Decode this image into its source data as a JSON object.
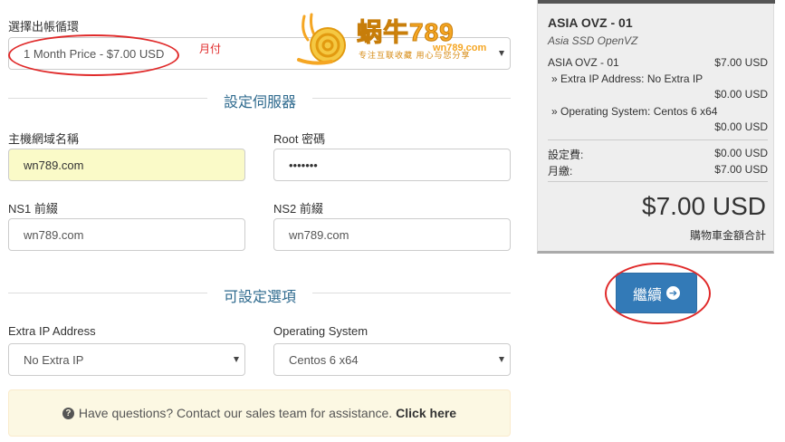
{
  "billing": {
    "label": "選擇出帳循環",
    "selected": "1 Month Price - $7.00 USD",
    "annotation": "月付"
  },
  "logo": {
    "cn_text": "蜗牛789",
    "url_text": "wn789.com",
    "tagline": "专注互联收藏   用心与您分享"
  },
  "server_section": {
    "title": "設定伺服器",
    "hostname_label": "主機網域名稱",
    "hostname_value": "wn789.com",
    "root_label": "Root 密碼",
    "root_value": "•••••••",
    "ns1_label": "NS1 前綴",
    "ns1_value": "wn789.com",
    "ns2_label": "NS2 前綴",
    "ns2_value": "wn789.com"
  },
  "options_section": {
    "title": "可設定選項",
    "extra_ip_label": "Extra IP Address",
    "extra_ip_selected": "No Extra IP",
    "os_label": "Operating System",
    "os_selected": "Centos 6 x64"
  },
  "help": {
    "text": "Have questions? Contact our sales team for assistance.",
    "link": "Click here"
  },
  "summary": {
    "product_name": "ASIA OVZ - 01",
    "product_group": "Asia SSD OpenVZ",
    "lines": [
      {
        "label": "ASIA OVZ - 01",
        "value": "$7.00 USD"
      },
      {
        "label": "» Extra IP Address: No Extra IP",
        "value": ""
      },
      {
        "label": "",
        "value": "$0.00 USD"
      },
      {
        "label": "» Operating System: Centos 6 x64",
        "value": ""
      },
      {
        "label": "",
        "value": "$0.00 USD"
      }
    ],
    "setup_label": "設定費:",
    "setup_value": "$0.00 USD",
    "monthly_label": "月繳:",
    "monthly_value": "$7.00 USD",
    "total": "$7.00 USD",
    "total_label": "購物車金額合計"
  },
  "continue_button": "繼續",
  "colors": {
    "primary": "#337ab7",
    "section_title": "#2e6a8e",
    "annotation": "#e02a2a",
    "highlight_input": "#fafac8",
    "help_bg": "#fcf8e3"
  }
}
